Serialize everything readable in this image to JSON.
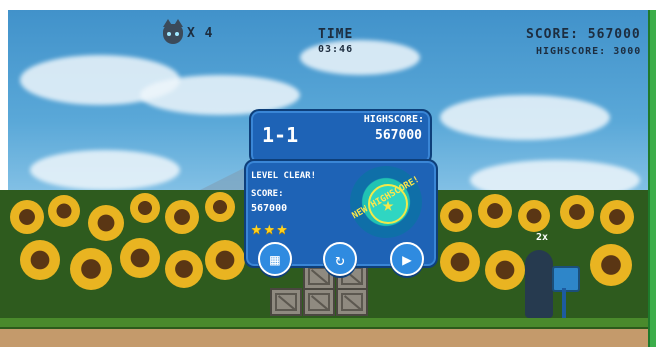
{
  "hud": {
    "lives": "X 4",
    "lives_icon": "cat-face-icon",
    "time_label": "TIME",
    "time_value": "03:46",
    "score": "SCORE: 567000",
    "highscore": "HIGHSCORE: 3000"
  },
  "results": {
    "level": "1-1",
    "highscore_label": "HIGHSCORE:",
    "highscore_value": "567000",
    "title": "LEVEL CLEAR!",
    "score_label": "SCORE:",
    "score_value": "567000",
    "stars": 3,
    "stars_max": 3,
    "stars_text": "★★★",
    "badge_text": "NEW HIGHSCORE!",
    "badge_symbol": "★"
  },
  "buttons": {
    "level_select_icon": "grid-icon",
    "level_select_symbol": "▦",
    "replay_icon": "replay-icon",
    "replay_symbol": "↻",
    "next_icon": "play-icon",
    "next_symbol": "▶"
  },
  "scene": {
    "multiplier": "2x"
  },
  "colors": {
    "panel": "#1e63b6",
    "panel_border": "#0e3f7a",
    "star": "#ffd21f",
    "badge": "#21c3b3",
    "sky": "#5aa8d8"
  }
}
